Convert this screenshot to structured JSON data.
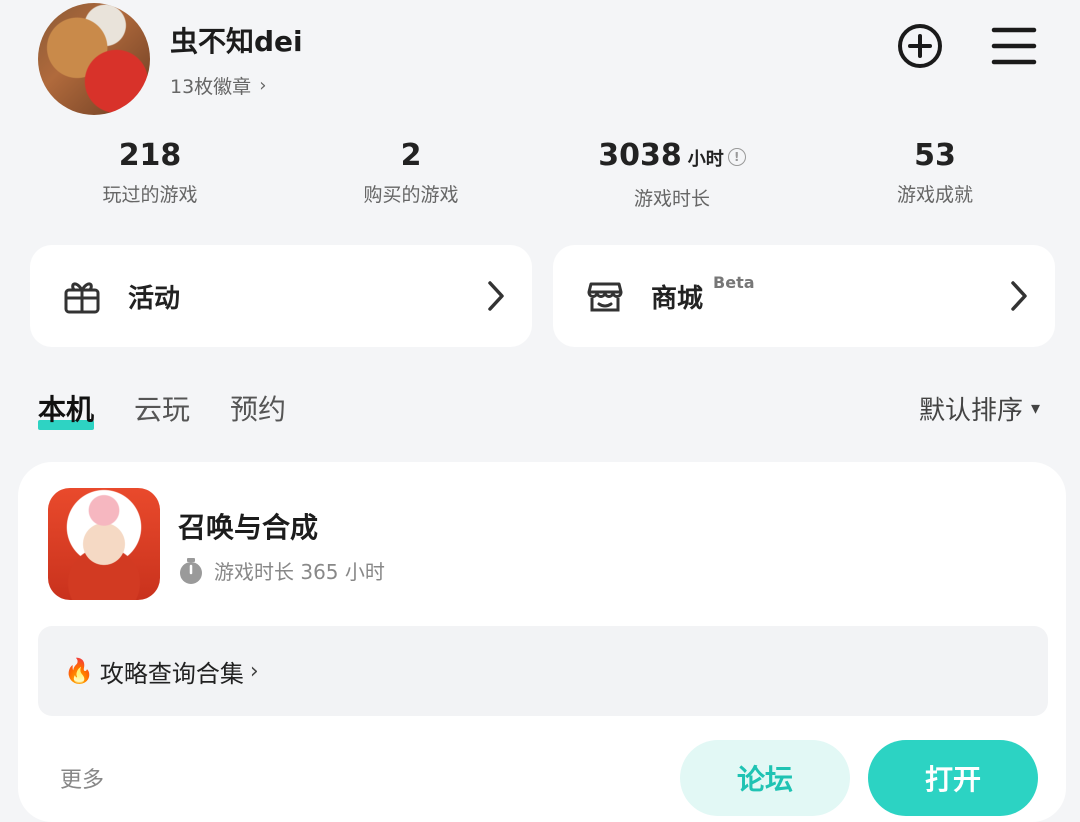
{
  "profile": {
    "username": "虫不知dei",
    "badges_label": "13枚徽章",
    "chevron": "›"
  },
  "stats": [
    {
      "value": "218",
      "label": "玩过的游戏"
    },
    {
      "value": "2",
      "label": "购买的游戏"
    },
    {
      "value": "3038",
      "unit": "小时",
      "label": "游戏时长"
    },
    {
      "value": "53",
      "label": "游戏成就"
    }
  ],
  "cards": {
    "activity": {
      "label": "活动",
      "icon": "gift-icon"
    },
    "store": {
      "label": "商城",
      "tag": "Beta",
      "icon": "store-icon"
    }
  },
  "tabs": [
    "本机",
    "云玩",
    "预约"
  ],
  "sort": {
    "label": "默认排序",
    "caret": "▾"
  },
  "game": {
    "name": "召唤与合成",
    "play_time": "游戏时长 365 小时",
    "guide": "攻略查询合集",
    "guide_emoji": "🔥",
    "more": "更多",
    "forum_button": "论坛",
    "open_button": "打开"
  },
  "colors": {
    "accent": "#2cd3c3",
    "accent_light": "#e2f8f5",
    "background": "#f4f5f7"
  }
}
